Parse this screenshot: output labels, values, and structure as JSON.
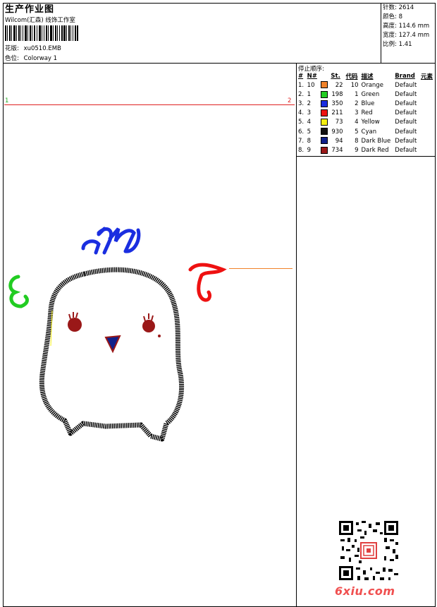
{
  "header": {
    "title": "生产作业图",
    "company": "Wilcom(汇森) 线饰工作室",
    "design_label": "花版:",
    "design_value": "xu0510.EMB",
    "colorway_label": "色位:",
    "colorway_value": "Colorway 1"
  },
  "stats": [
    {
      "label": "针数:",
      "value": "2614"
    },
    {
      "label": "颜色:",
      "value": "8"
    },
    {
      "label": "高度:",
      "value": "114.6 mm"
    },
    {
      "label": "宽度:",
      "value": "127.4 mm"
    },
    {
      "label": "比例:",
      "value": "1.41"
    }
  ],
  "color_list": {
    "title": "停止顺序:",
    "headers": {
      "index": "#",
      "n": "N#",
      "st": "St.",
      "code": "代码",
      "desc": "描述",
      "brand": "Brand",
      "elem": "元素"
    },
    "rows": [
      {
        "index": "1.",
        "n": "10",
        "color": "#f0822a",
        "st": "22",
        "code": "10",
        "desc": "Orange",
        "brand": "Default"
      },
      {
        "index": "2.",
        "n": "1",
        "color": "#22cc22",
        "st": "198",
        "code": "1",
        "desc": "Green",
        "brand": "Default"
      },
      {
        "index": "3.",
        "n": "2",
        "color": "#1a2ee0",
        "st": "350",
        "code": "2",
        "desc": "Blue",
        "brand": "Default"
      },
      {
        "index": "4.",
        "n": "3",
        "color": "#ee1111",
        "st": "211",
        "code": "3",
        "desc": "Red",
        "brand": "Default"
      },
      {
        "index": "5.",
        "n": "4",
        "color": "#f4ee10",
        "st": "73",
        "code": "4",
        "desc": "Yellow",
        "brand": "Default"
      },
      {
        "index": "6.",
        "n": "5",
        "color": "#111111",
        "st": "930",
        "code": "5",
        "desc": "Cyan",
        "brand": "Default"
      },
      {
        "index": "7.",
        "n": "8",
        "color": "#10208a",
        "st": "94",
        "code": "8",
        "desc": "Dark Blue",
        "brand": "Default"
      },
      {
        "index": "8.",
        "n": "9",
        "color": "#9a1818",
        "st": "734",
        "code": "9",
        "desc": "Dark Red",
        "brand": "Default"
      }
    ]
  },
  "canvas": {
    "marker_start": "1",
    "marker_end": "2"
  },
  "watermark": "6xiu.com",
  "colors": {
    "border": "#000000",
    "red_line": "#e02020",
    "green_marker": "#22aa22",
    "orange_line": "#f0822a",
    "watermark": "#f05050"
  }
}
